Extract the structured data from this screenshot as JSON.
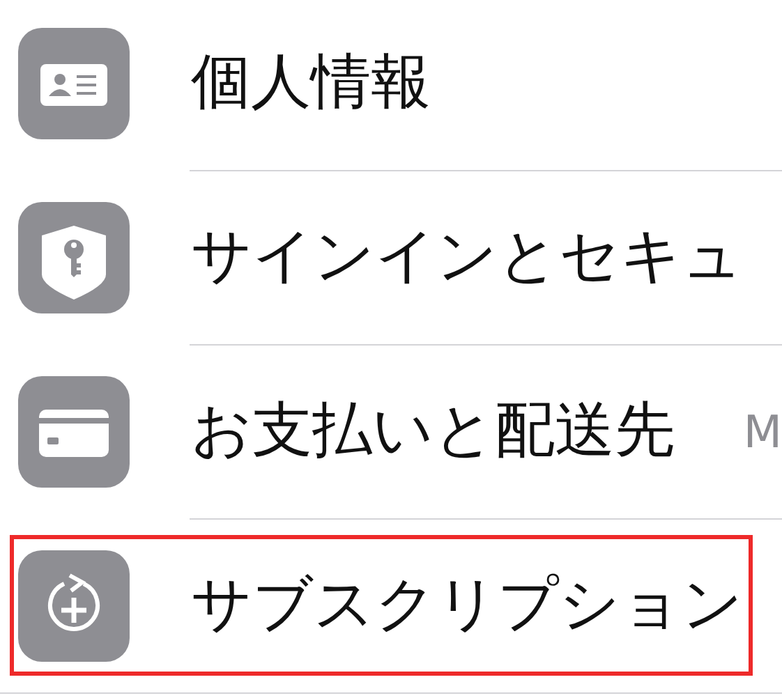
{
  "items": [
    {
      "label": "個人情報",
      "kind": "contact-card",
      "highlighted": false
    },
    {
      "label": "サインインとセキュ",
      "kind": "shield-key",
      "highlighted": false
    },
    {
      "label": "お支払いと配送先",
      "detail": "M",
      "kind": "credit-card",
      "highlighted": false
    },
    {
      "label": "サブスクリプション",
      "kind": "subscription",
      "highlighted": true
    }
  ]
}
